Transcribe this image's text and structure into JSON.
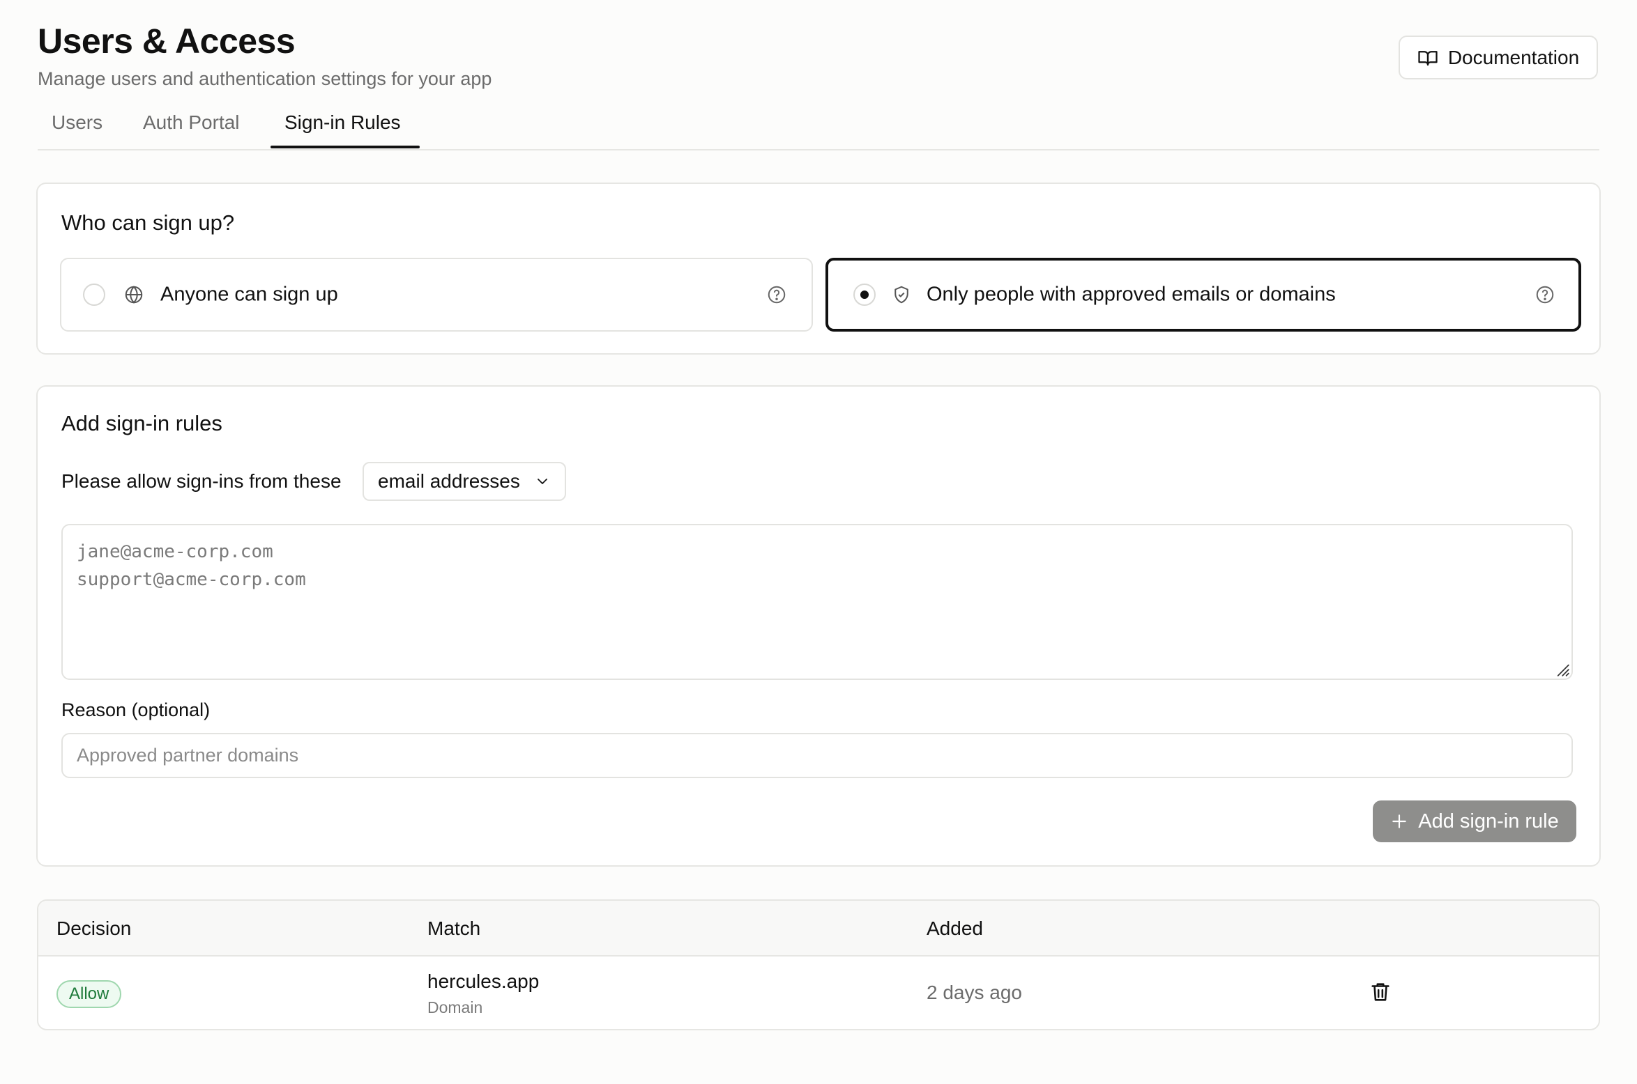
{
  "header": {
    "title": "Users & Access",
    "subtitle": "Manage users and authentication settings for your app",
    "doc_button": "Documentation",
    "doc_icon": "book-open-icon"
  },
  "tabs": [
    {
      "label": "Users",
      "active": false
    },
    {
      "label": "Auth Portal",
      "active": false
    },
    {
      "label": "Sign-in Rules",
      "active": true
    }
  ],
  "signup": {
    "title": "Who can sign up?",
    "options": [
      {
        "label": "Anyone can sign up",
        "icon": "globe-icon",
        "selected": false
      },
      {
        "label": "Only people with approved emails or domains",
        "icon": "shield-check-icon",
        "selected": true
      }
    ]
  },
  "rules": {
    "title": "Add sign-in rules",
    "allow_label": "Please allow sign-ins from these",
    "select_value": "email addresses",
    "textarea_placeholder_lines": [
      "jane@acme-corp.com",
      "support@acme-corp.com"
    ],
    "reason_label": "Reason (optional)",
    "reason_placeholder": "Approved partner domains",
    "add_button": "Add sign-in rule"
  },
  "table": {
    "headers": [
      "Decision",
      "Match",
      "Added"
    ],
    "rows": [
      {
        "decision": "Allow",
        "match": "hercules.app",
        "match_type": "Domain",
        "added": "2 days ago"
      }
    ]
  },
  "colors": {
    "accent": "#111111",
    "allow_badge_text": "#1e7a3a",
    "allow_badge_bg": "#eefaf1",
    "disabled_button": "#8e8e8c"
  }
}
